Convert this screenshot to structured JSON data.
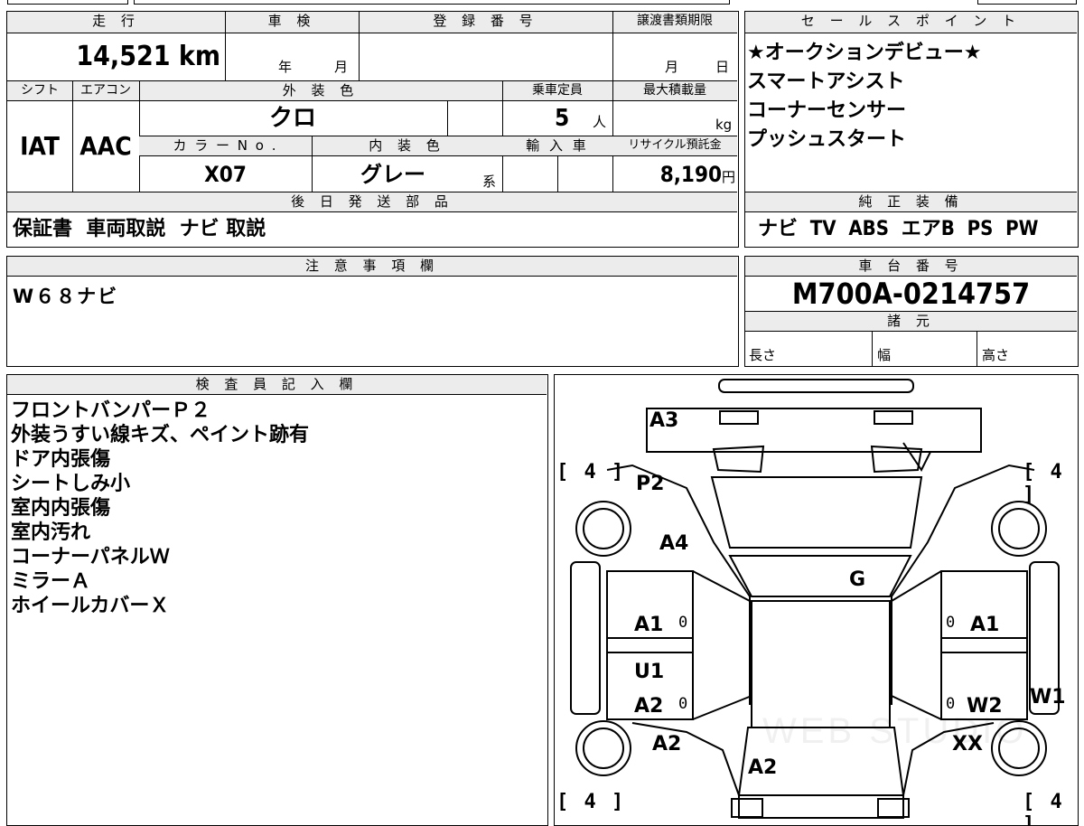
{
  "headers": {
    "mileage": "走 行",
    "inspection": "車 検",
    "registration": "登 録 番 号",
    "transfer_deadline": "譲渡書類期限",
    "shift": "シフト",
    "aircon": "エアコン",
    "exterior_color": "外 装 色",
    "capacity": "乗車定員",
    "max_load": "最大積載量",
    "color_no": "カ ラ ー N o .",
    "interior_color": "内 装 色",
    "import": "輸 入 車",
    "recycle_fee": "リサイクル預託金",
    "later_parts": "後 日 発 送 部 品",
    "sales_points": "セ ー ル ス ポ イ ン ト",
    "genuine_equipment": "純 正 装 備",
    "notes": "注 意 事 項 欄",
    "chassis_no": "車 台 番 号",
    "specs": "諸 元",
    "inspector": "検 査 員 記 入 欄"
  },
  "values": {
    "mileage": "14,521",
    "mileage_unit": "km",
    "inspection_year": "年",
    "inspection_month": "月",
    "deadline_month": "月",
    "deadline_day": "日",
    "shift": "IAT",
    "aircon": "AAC",
    "exterior_color": "クロ",
    "capacity": "5",
    "capacity_unit": "人",
    "max_load_unit": "kg",
    "color_no": "X07",
    "interior_color": "グレー",
    "interior_suffix": "系",
    "recycle_fee": "8,190",
    "recycle_unit": "円",
    "later_parts": "保証書  車両取説  ナビ 取説",
    "genuine_equipment": "ナビ  TV  ABS  エアB  PS  PW",
    "notes": "W６８ナビ",
    "chassis_no": "M700A-0214757",
    "spec_length": "長さ",
    "spec_width": "幅",
    "spec_height": "高さ"
  },
  "sales_points": [
    "★オークションデビュー★",
    "スマートアシスト",
    "コーナーセンサー",
    "プッシュスタート"
  ],
  "inspector_notes": [
    "フロントバンパーＰ２",
    "外装うすい線キズ、ペイント跡有",
    "ドア内張傷",
    "シートしみ小",
    "室内内張傷",
    "室内汚れ",
    "コーナーパネルＷ",
    "ミラーＡ",
    "ホイールカバーＸ"
  ],
  "diagram": {
    "front_bumper": "A3",
    "bonnet_left": "P2",
    "fender_left": "A4",
    "windshield": "G",
    "front_door_left": "A1",
    "front_door_right": "A1",
    "rocker_left": "U1",
    "rear_door_left": "A2",
    "rear_door_right": "W2",
    "rear_quarter_right": "W1",
    "rear_fender_left": "A2",
    "rear_fender_right": "XX",
    "rear_gate": "A2",
    "tire_fl": "[ 4 ]",
    "tire_fr": "[ 4 ]",
    "tire_rl": "[ 4 ]",
    "tire_rr": "[ 4 ]",
    "zero": "0",
    "watermark": "WEB STUDIO"
  }
}
